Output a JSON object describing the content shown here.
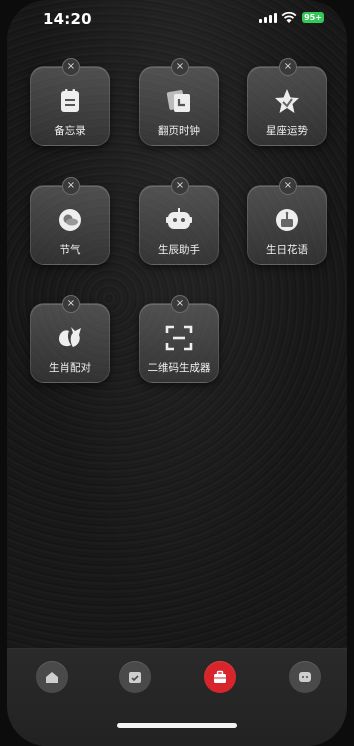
{
  "status": {
    "time": "14:20",
    "battery": "95+"
  },
  "tiles": [
    {
      "label": "备忘录",
      "icon": "memo-icon"
    },
    {
      "label": "翻页时钟",
      "icon": "flip-clock-icon"
    },
    {
      "label": "星座运势",
      "icon": "star-icon"
    },
    {
      "label": "节气",
      "icon": "weather-icon"
    },
    {
      "label": "生辰助手",
      "icon": "robot-icon"
    },
    {
      "label": "生日花语",
      "icon": "cake-icon"
    },
    {
      "label": "生肖配对",
      "icon": "zodiac-animal-icon"
    },
    {
      "label": "二维码生成器",
      "icon": "qr-scan-icon"
    }
  ],
  "dock": [
    {
      "icon": "home-icon",
      "active": false
    },
    {
      "icon": "calendar-check-icon",
      "active": false
    },
    {
      "icon": "toolbox-icon",
      "active": true
    },
    {
      "icon": "chat-icon",
      "active": false
    }
  ],
  "delete_badge": "×",
  "colors": {
    "active_tab": "#d8252b",
    "battery": "#35c759"
  }
}
